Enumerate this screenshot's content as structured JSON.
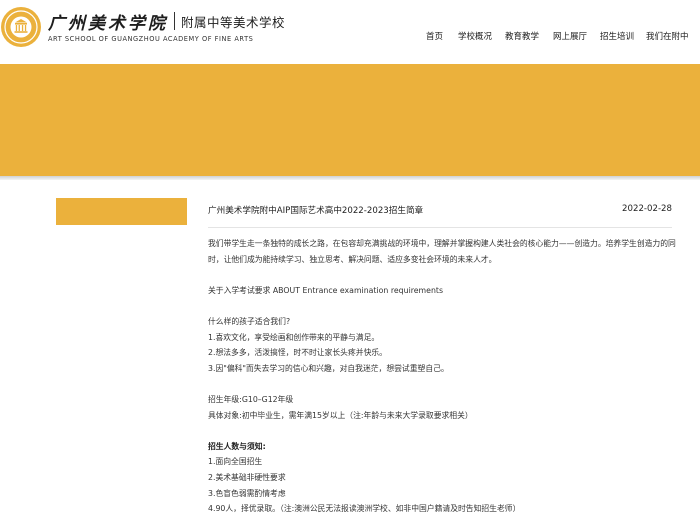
{
  "header": {
    "logo_calligraphy": "广州美术学院",
    "logo_subtitle": "附属中等美术学校",
    "logo_english": "ART SCHOOL OF GUANGZHOU ACADEMY OF FINE ARTS",
    "seal_color": "#ebb13c"
  },
  "nav": [
    "首页",
    "学校概况",
    "教育教学",
    "网上展厅",
    "招生培训",
    "我们在附中"
  ],
  "banner_color": "#ebb13c",
  "article": {
    "title": "广州美术学院附中AIP国际艺术高中2022-2023招生简章",
    "date": "2022-02-28",
    "intro_1": "我们带学生走一条独特的成长之路，在包容却充满挑战的环境中，理解并掌握构建人类社会的核心能力——创造力。培养学生创造力的同",
    "intro_2": "时，让他们成为能持续学习、独立思考、解决问题、适应多变社会环境的未来人才。",
    "requirements_heading": "关于入学考试要求 ABOUT Entrance examination requirements",
    "fit_question": "什么样的孩子适合我们?",
    "fit_1": "1.喜欢文化，享受绘画和创作带来的平静与满足。",
    "fit_2": "2.想法多多，活泼搞怪，时不时让家长头疼并快乐。",
    "fit_3": "3.因\"偏科\"而失去学习的信心和兴趣，对自我迷茫，想尝试重塑自己。",
    "grade": "招生年级:G10–G12年级",
    "target": "具体对象:初中毕业生，需年满15岁以上（注:年龄与未来大学录取要求相关）",
    "quota_heading": "招生人数与须知:",
    "quota_1": "1.面向全国招生",
    "quota_2": "2.美术基础非硬性要求",
    "quota_3": "3.色盲色弱需酌情考虑",
    "quota_4": "4.90人，择优录取。（注:澳洲公民无法报读澳洲学校、如非中国户籍请及时告知招生老师）"
  }
}
